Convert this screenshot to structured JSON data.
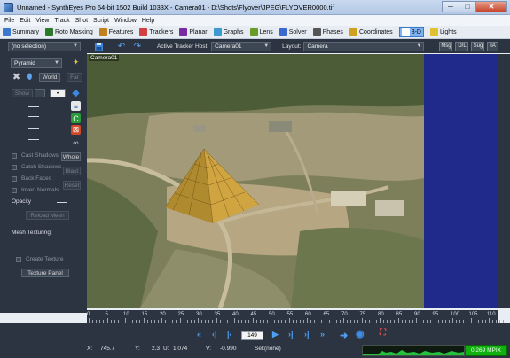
{
  "window": {
    "title": "Unnamed - SynthEyes Pro 64-bit 1502 Build 1033X - Camera01 - D:\\Shots\\Flyover\\JPEG\\FLYOVER0000.tif",
    "minimize": "─",
    "maximize": "□",
    "close": "✕"
  },
  "menu": [
    "File",
    "Edit",
    "View",
    "Track",
    "Shot",
    "Script",
    "Window",
    "Help"
  ],
  "rooms": [
    {
      "label": "Summary",
      "color": "#3a78d0"
    },
    {
      "label": "Roto Masking",
      "color": "#2a7a2a"
    },
    {
      "label": "Features",
      "color": "#c08020"
    },
    {
      "label": "Trackers",
      "color": "#d04040"
    },
    {
      "label": "Planar",
      "color": "#7a2aa0"
    },
    {
      "label": "Graphs",
      "color": "#3a9ad0"
    },
    {
      "label": "Lens",
      "color": "#6a9a2a"
    },
    {
      "label": "Solver",
      "color": "#3a6ad0"
    },
    {
      "label": "Phases",
      "color": "#555555"
    },
    {
      "label": "Coordinates",
      "color": "#d0a020"
    },
    {
      "label": "3-D",
      "color": "#1a4ab0"
    },
    {
      "label": "Lights",
      "color": "#e0c030"
    }
  ],
  "toolbar": {
    "selection": "(no selection)",
    "active_tracker_host_label": "Active Tracker Host:",
    "active_tracker_host_value": "Camera01",
    "layout_label": "Layout:",
    "layout_value": "Camera",
    "chips": [
      "Msg",
      "D/L",
      "Sug",
      "IA"
    ]
  },
  "left_panel": {
    "object_type": "Pyramid",
    "world_button": "World",
    "far_button": "Far",
    "show_button": "Show",
    "cast_shadows": "Cast Shadows",
    "whole_button": "Whole",
    "catch_shadows": "Catch Shadows",
    "blast_button": "Blast",
    "back_faces": "Back Faces",
    "reset_button": "Reset",
    "invert_normals": "Invert Normals",
    "opacity_label": "Opacity",
    "reload_mesh": "Reload Mesh",
    "mesh_texturing_label": "Mesh Texturing:",
    "create_texture": "Create Texture",
    "texture_panel": "Texture Panel"
  },
  "viewport": {
    "camera_label": "Camera01"
  },
  "timeline": {
    "ticks": [
      "0",
      "5",
      "10",
      "15",
      "20",
      "25",
      "30",
      "35",
      "40",
      "45",
      "50",
      "55",
      "60",
      "65",
      "70",
      "75",
      "80",
      "85",
      "90",
      "95",
      "100",
      "105",
      "110"
    ]
  },
  "transport": {
    "frame": "149"
  },
  "status": {
    "x_label": "X:",
    "x_value": "745.7",
    "y_label": "Y:",
    "y_value": "2.3",
    "u_label": "U:",
    "u_value": "1.074",
    "v_label": "V:",
    "v_value": "-0.990",
    "sel_label": "Sel:",
    "sel_value": "(none)",
    "mpix": "0.269 MPIX"
  }
}
